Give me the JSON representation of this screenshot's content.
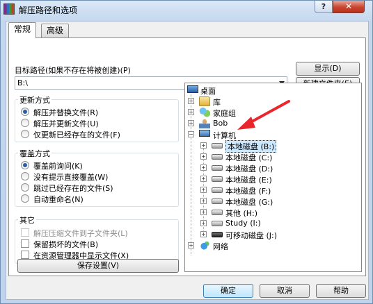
{
  "window": {
    "title": "解压路径和选项",
    "help_label": "?",
    "close_label": "✕"
  },
  "tabs": [
    {
      "label": "常规",
      "active": true
    },
    {
      "label": "高级",
      "active": false
    }
  ],
  "target_path": {
    "label": "目标路径(如果不存在将被创建)(P)",
    "value": "B:\\"
  },
  "buttons": {
    "show": "显示(D)",
    "new_folder": "新建文件夹(E)",
    "save_settings": "保存设置(V)",
    "ok": "确定",
    "cancel": "取消",
    "help": "帮助"
  },
  "update_mode": {
    "title": "更新方式",
    "options": [
      {
        "label": "解压并替换文件(R)",
        "selected": true
      },
      {
        "label": "解压并更新文件(U)",
        "selected": false
      },
      {
        "label": "仅更新已经存在的文件(F)",
        "selected": false
      }
    ]
  },
  "overwrite_mode": {
    "title": "覆盖方式",
    "options": [
      {
        "label": "覆盖前询问(K)",
        "selected": true
      },
      {
        "label": "没有提示直接覆盖(W)",
        "selected": false
      },
      {
        "label": "跳过已经存在的文件(S)",
        "selected": false
      },
      {
        "label": "自动重命名(N)",
        "selected": false
      }
    ]
  },
  "other": {
    "title": "其它",
    "options": [
      {
        "label": "解压压缩文件到子文件夹(L)",
        "checked": false,
        "disabled": true
      },
      {
        "label": "保留损坏的文件(B)",
        "checked": false,
        "disabled": false
      },
      {
        "label": "在资源管理器中显示文件(X)",
        "checked": false,
        "disabled": false
      }
    ]
  },
  "tree": {
    "desktop": "桌面",
    "library": "库",
    "homegroup": "家庭组",
    "user": "Bob",
    "computer": "计算机",
    "drives": [
      {
        "label": "本地磁盘 (B:)",
        "selected": true
      },
      {
        "label": "本地磁盘 (C:)",
        "selected": false
      },
      {
        "label": "本地磁盘 (D:)",
        "selected": false
      },
      {
        "label": "本地磁盘 (E:)",
        "selected": false
      },
      {
        "label": "本地磁盘 (F:)",
        "selected": false
      },
      {
        "label": "本地磁盘 (G:)",
        "selected": false
      },
      {
        "label": "其他 (H:)",
        "selected": false
      },
      {
        "label": "Study (I:)",
        "selected": false
      }
    ],
    "removable": "可移动磁盘 (J:)",
    "network": "网络"
  },
  "colors": {
    "annotation_arrow": "#e8262b",
    "selection": "#cce8ff"
  }
}
